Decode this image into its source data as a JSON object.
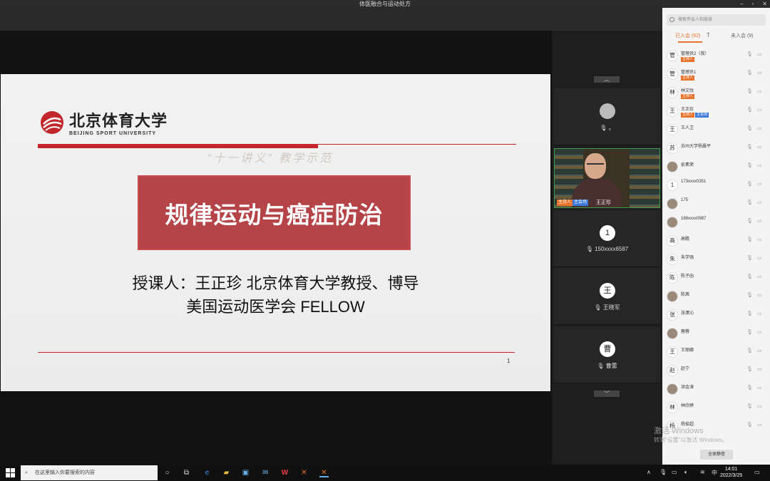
{
  "window": {
    "title": "体医融合与运动处方",
    "controls": [
      "–",
      "▫",
      "✕"
    ]
  },
  "slide": {
    "logo_cn": "北京体育大学",
    "logo_en": "BEIJING SPORT UNIVERSITY",
    "faint_text": "“十一讲义” 教学示范",
    "title": "规律运动与癌症防治",
    "lecturer_line1": "授课人：王正珍  北京体育大学教授、博导",
    "lecturer_line2": "美国运动医学会  FELLOW",
    "page_number": "1",
    "accent_color": "#c4262e"
  },
  "video_strip": {
    "up_arrow": "︿",
    "down_arrow": "﹀",
    "tiles": [
      {
        "avatar": "",
        "name": "。"
      },
      {
        "avatar": "1",
        "name": "150xxxx6587"
      },
      {
        "avatar": "王",
        "name": "王晓军"
      },
      {
        "avatar": "曹",
        "name": "曹蕾"
      }
    ],
    "active_video": {
      "tag_host": "主持人",
      "tag_co": "主会场",
      "name": "王正珍"
    }
  },
  "participants": {
    "search_placeholder": "搜索参会人和链接",
    "tab_joined": "已入会 (62)",
    "tab_not_joined": "未入会 (9)",
    "filter_icon": "T",
    "mute_all": "全体静音",
    "list": [
      {
        "avatar": "管",
        "name": "管理员2（我）",
        "tag": "主持人"
      },
      {
        "avatar": "管",
        "name": "管理员1",
        "tag": "主持人"
      },
      {
        "avatar": "林",
        "name": "林文弢",
        "tag": "主持人"
      },
      {
        "avatar": "王",
        "name": "王正珍",
        "tag": "主持人",
        "tag2": "主会场"
      },
      {
        "avatar": "王",
        "name": "王人卫"
      },
      {
        "avatar": "苏",
        "name": "苏州大学杨晨平"
      },
      {
        "avatar": "",
        "name": "俞素荣"
      },
      {
        "avatar": "1",
        "name": "173xxxx0351"
      },
      {
        "avatar": "",
        "name": "175"
      },
      {
        "avatar": "",
        "name": "188xxxx0987"
      },
      {
        "avatar": "高",
        "name": "高瞻"
      },
      {
        "avatar": "朱",
        "name": "朱学强"
      },
      {
        "avatar": "陈",
        "name": "陈子函"
      },
      {
        "avatar": "",
        "name": "陈茜"
      },
      {
        "avatar": "张",
        "name": "张潇沁"
      },
      {
        "avatar": "",
        "name": "蓉蓉"
      },
      {
        "avatar": "王",
        "name": "王丽娜"
      },
      {
        "avatar": "赵",
        "name": "赵宁"
      },
      {
        "avatar": "",
        "name": "洪金涛"
      },
      {
        "avatar": "林",
        "name": "林欣婷"
      },
      {
        "avatar": "杨",
        "name": "杨俊超"
      }
    ]
  },
  "watermark": {
    "line1": "激活 Windows",
    "line2": "转到“设置”以激活 Windows。"
  },
  "taskbar": {
    "search_placeholder": "在这里输入你要搜索的内容",
    "ime": "中",
    "time": "14:01",
    "date": "2022/3/25"
  }
}
